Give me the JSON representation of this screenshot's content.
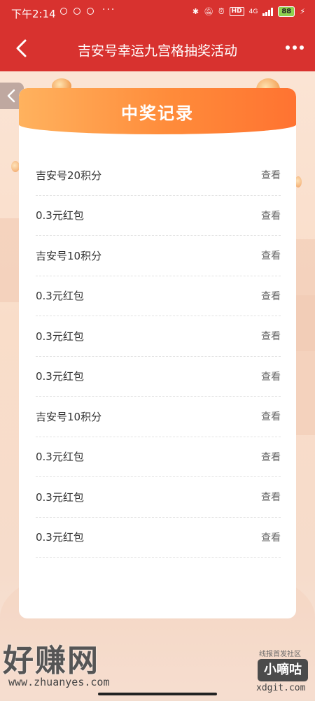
{
  "status_bar": {
    "time": "下午2:14",
    "dots": "···",
    "network": "4G",
    "hd": "HD",
    "battery": "88"
  },
  "header": {
    "title": "吉安号幸运九宫格抽奖活动",
    "color": "#d8322f"
  },
  "card": {
    "title": "中奖记录",
    "rows": [
      {
        "label": "吉安号20积分",
        "action": "查看"
      },
      {
        "label": "0.3元红包",
        "action": "查看"
      },
      {
        "label": "吉安号10积分",
        "action": "查看"
      },
      {
        "label": "0.3元红包",
        "action": "查看"
      },
      {
        "label": "0.3元红包",
        "action": "查看"
      },
      {
        "label": "0.3元红包",
        "action": "查看"
      },
      {
        "label": "吉安号10积分",
        "action": "查看"
      },
      {
        "label": "0.3元红包",
        "action": "查看"
      },
      {
        "label": "0.3元红包",
        "action": "查看"
      },
      {
        "label": "0.3元红包",
        "action": "查看"
      }
    ]
  },
  "watermark": {
    "left_text": "好赚网",
    "left_url": "www.zhuanyes.com",
    "right_small": "线报首发社区",
    "right_badge": "小嘀咕",
    "right_url": "xdgit.com"
  }
}
